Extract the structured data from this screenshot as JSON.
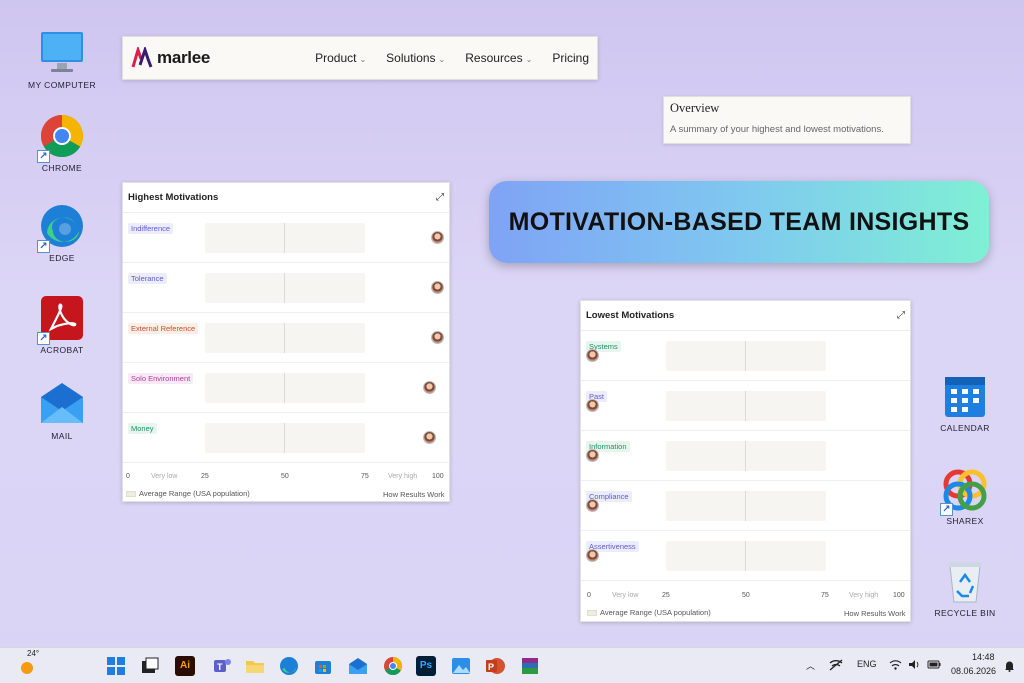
{
  "desktop": {
    "icons_left": [
      {
        "label": "MY COMPUTER",
        "icon": "monitor-icon"
      },
      {
        "label": "CHROME",
        "icon": "chrome-icon"
      },
      {
        "label": "EDGE",
        "icon": "edge-icon"
      },
      {
        "label": "ACROBAT",
        "icon": "acrobat-icon"
      },
      {
        "label": "MAIL",
        "icon": "mail-icon"
      }
    ],
    "icons_right": [
      {
        "label": "CALENDAR",
        "icon": "calendar-icon"
      },
      {
        "label": "SHAREX",
        "icon": "sharex-icon"
      },
      {
        "label": "RECYCLE BIN",
        "icon": "recycle-bin-icon"
      }
    ]
  },
  "nav": {
    "logo": "marlee",
    "links": [
      "Product",
      "Solutions",
      "Resources",
      "Pricing"
    ]
  },
  "overview": {
    "title": "Overview",
    "subtitle": "A summary of your highest and lowest motivations."
  },
  "banner": {
    "text": "MOTIVATION-BASED TEAM INSIGHTS"
  },
  "highest": {
    "title": "Highest Motivations",
    "rows": [
      {
        "label": "Indifference",
        "color": "#5b5bd6",
        "bg": "#ececfb"
      },
      {
        "label": "Tolerance",
        "color": "#5b5bd6",
        "bg": "#ececfb"
      },
      {
        "label": "External Reference",
        "color": "#c0532b",
        "bg": "#fbeee8"
      },
      {
        "label": "Solo Environment",
        "color": "#b53c9a",
        "bg": "#f8eaf4"
      },
      {
        "label": "Money",
        "color": "#1f8f6b",
        "bg": "#e6f6ef"
      }
    ],
    "scale": {
      "s0": "0",
      "vlow": "Very low",
      "s25": "25",
      "s50": "50",
      "s75": "75",
      "vhigh": "Very high",
      "s100": "100"
    },
    "legend": "Average Range (USA population)",
    "how": "How Results Work"
  },
  "lowest": {
    "title": "Lowest Motivations",
    "rows": [
      {
        "label": "Systems",
        "color": "#1f8f6b",
        "bg": "#e6f6ef"
      },
      {
        "label": "Past",
        "color": "#5b5bd6",
        "bg": "#ececfb"
      },
      {
        "label": "Information",
        "color": "#1f8f6b",
        "bg": "#e6f6ef"
      },
      {
        "label": "Compliance",
        "color": "#5b5bd6",
        "bg": "#ececfb"
      },
      {
        "label": "Assertiveness",
        "color": "#5b5bd6",
        "bg": "#ececfb"
      }
    ],
    "scale": {
      "s0": "0",
      "vlow": "Very low",
      "s25": "25",
      "s50": "50",
      "s75": "75",
      "vhigh": "Very high",
      "s100": "100"
    },
    "legend": "Average Range (USA population)",
    "how": "How Results Work"
  },
  "taskbar": {
    "weather": "24°",
    "lang": "ENG",
    "time": "14:48",
    "date": "08.06.2026"
  }
}
